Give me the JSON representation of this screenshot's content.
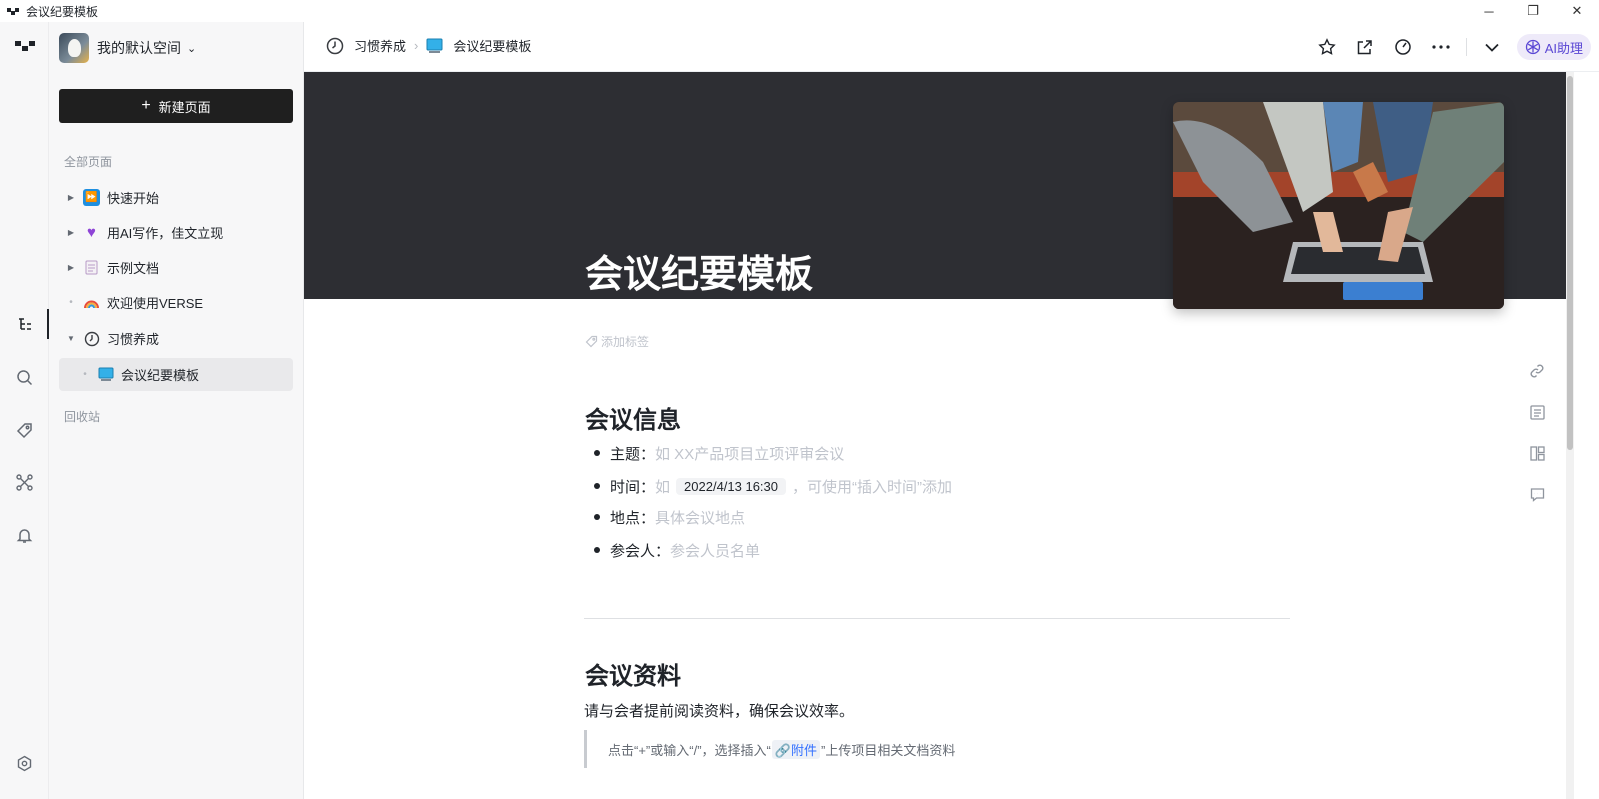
{
  "window": {
    "title": "会议纪要模板",
    "controls": {
      "minimize": "─",
      "maximize": "❐",
      "close": "✕"
    }
  },
  "workspace": {
    "name": "我的默认空间"
  },
  "sidebar": {
    "new_page_label": "新建页面",
    "all_pages_label": "全部页面",
    "trash_label": "回收站",
    "items": [
      {
        "label": "快速开始",
        "icon": "fast-forward-emoji"
      },
      {
        "label": "用AI写作，佳文立现",
        "icon": "purple-heart-emoji"
      },
      {
        "label": "示例文档",
        "icon": "page-emoji"
      },
      {
        "label": "欢迎使用VERSE",
        "icon": "rainbow-emoji"
      },
      {
        "label": "习惯养成",
        "icon": "clock-icon"
      },
      {
        "label": "会议纪要模板",
        "icon": "computer-emoji"
      }
    ]
  },
  "breadcrumb": {
    "parent": "习惯养成",
    "current": "会议纪要模板"
  },
  "toolbar": {
    "ai_label": "AI助理"
  },
  "document": {
    "title": "会议纪要模板",
    "add_tag": "添加标签",
    "section1_heading": "会议信息",
    "info": {
      "topic_label": "主题：",
      "topic_placeholder": "如 XX产品项目立项评审会议",
      "time_label": "时间：",
      "time_prefix": "如",
      "time_chip": "2022/4/13 16:30",
      "time_suffix": "，可使用“插入时间”添加",
      "place_label": "地点：",
      "place_placeholder": "具体会议地点",
      "attendees_label": "参会人：",
      "attendees_placeholder": "参会人员名单"
    },
    "section2_heading": "会议资料",
    "section2_para": "请与会者提前阅读资料，确保会议效率。",
    "quote": {
      "pre": "点击“+”或输入“/”，选择插入“",
      "chip": "🔗附件",
      "post": "”上传项目相关文档资料"
    }
  }
}
